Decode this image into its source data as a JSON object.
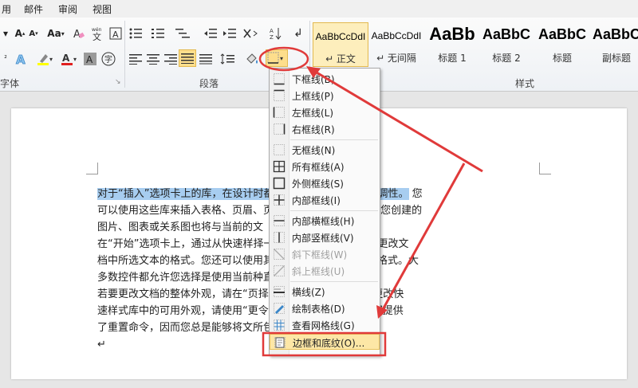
{
  "tabs": [
    "用",
    "邮件",
    "审阅",
    "视图"
  ],
  "ribbon": {
    "groups": {
      "font": "字体",
      "paragraph": "段落",
      "styles": "样式"
    },
    "styles": [
      {
        "sample": "AaBbCcDdI",
        "name": "↵ 正文",
        "active": true
      },
      {
        "sample": "AaBbCcDdI",
        "name": "↵ 无间隔",
        "active": false
      },
      {
        "sample": "AaBb",
        "name": "标题 1",
        "active": false
      },
      {
        "sample": "AaBbC",
        "name": "标题 2",
        "active": false
      },
      {
        "sample": "AaBbC",
        "name": "标题",
        "active": false
      },
      {
        "sample": "AaBbC",
        "name": "副标题",
        "active": false
      }
    ],
    "font_buttons": {
      "grow": "A",
      "shrink": "A",
      "case": "Aa",
      "clear": "A",
      "pinyin": "wén",
      "border_char": "A"
    },
    "colors": {
      "highlight": "#ffff00",
      "font_red": "#e02020",
      "accent_gold": "#e3b94f",
      "annot_red": "#e03a3a"
    }
  },
  "menu": {
    "items": [
      {
        "label": "下框线(B)",
        "icon": "border-bottom-icon",
        "disabled": false
      },
      {
        "label": "上框线(P)",
        "icon": "border-top-icon",
        "disabled": false
      },
      {
        "label": "左框线(L)",
        "icon": "border-left-icon",
        "disabled": false
      },
      {
        "label": "右框线(R)",
        "icon": "border-right-icon",
        "disabled": false
      },
      {
        "label": "无框线(N)",
        "icon": "border-none-icon",
        "disabled": false
      },
      {
        "label": "所有框线(A)",
        "icon": "border-all-icon",
        "disabled": false
      },
      {
        "label": "外侧框线(S)",
        "icon": "border-outside-icon",
        "disabled": false
      },
      {
        "label": "内部框线(I)",
        "icon": "border-inside-icon",
        "disabled": false
      },
      {
        "label": "内部横框线(H)",
        "icon": "border-inside-horizontal-icon",
        "disabled": false
      },
      {
        "label": "内部竖框线(V)",
        "icon": "border-inside-vertical-icon",
        "disabled": false
      },
      {
        "label": "斜下框线(W)",
        "icon": "diagonal-down-icon",
        "disabled": true
      },
      {
        "label": "斜上框线(U)",
        "icon": "diagonal-up-icon",
        "disabled": true
      },
      {
        "label": "横线(Z)",
        "icon": "horizontal-line-icon",
        "disabled": false
      },
      {
        "label": "绘制表格(D)",
        "icon": "draw-table-icon",
        "disabled": false
      },
      {
        "label": "查看网格线(G)",
        "icon": "view-gridlines-icon",
        "disabled": false
      },
      {
        "label": "边框和底纹(O)...",
        "icon": "borders-shading-icon",
        "disabled": false,
        "hot": true
      }
    ]
  },
  "document": {
    "lines": [
      {
        "pre": "",
        "hl": "对于“插入”选项卡上的库，在设计时都",
        "mid": "",
        "hl2": "项与文档整体外观的协调性。",
        "post": " 您"
      },
      {
        "pre": "可以使用这些库来插入表格、页眉、页",
        "hl": "",
        "mid": "",
        "hl2": "",
        "post": "及其他文档构建基块。 您创建的"
      },
      {
        "pre": "图片、图表或关系图也将与当前的文",
        "hl": "",
        "mid": "",
        "hl2": "",
        "post": ""
      },
      {
        "pre": "在“开始”选项卡上，通过从快速样",
        "hl": "",
        "mid": "",
        "hl2": "",
        "post": "择一种外观，您可以方便地更改文"
      },
      {
        "pre": "档中所选文本的格式。您还可以使用",
        "hl": "",
        "mid": "",
        "hl2": "",
        "post": "其他控件来直接设置文本格式。大"
      },
      {
        "pre": "多数控件都允许您选择是使用当前",
        "hl": "",
        "mid": "",
        "hl2": "",
        "post": "种直接指定的格式。↵"
      },
      {
        "pre": "若要更改文档的整体外观，请在“页",
        "hl": "",
        "mid": "",
        "hl2": "",
        "post": "择新的“主题”元素。若要更改快"
      },
      {
        "pre": "速样式库中的可用外观，请使用“更",
        "hl": "",
        "mid": "",
        "hl2": "",
        "post": "令。主题库和快速样式库都提供"
      },
      {
        "pre": "了重置命令，因而您总是能够将文",
        "hl": "",
        "mid": "",
        "hl2": "",
        "post": "所包含的原始外观。↵"
      },
      {
        "pre": "↵",
        "hl": "",
        "mid": "",
        "hl2": "",
        "post": ""
      }
    ]
  }
}
